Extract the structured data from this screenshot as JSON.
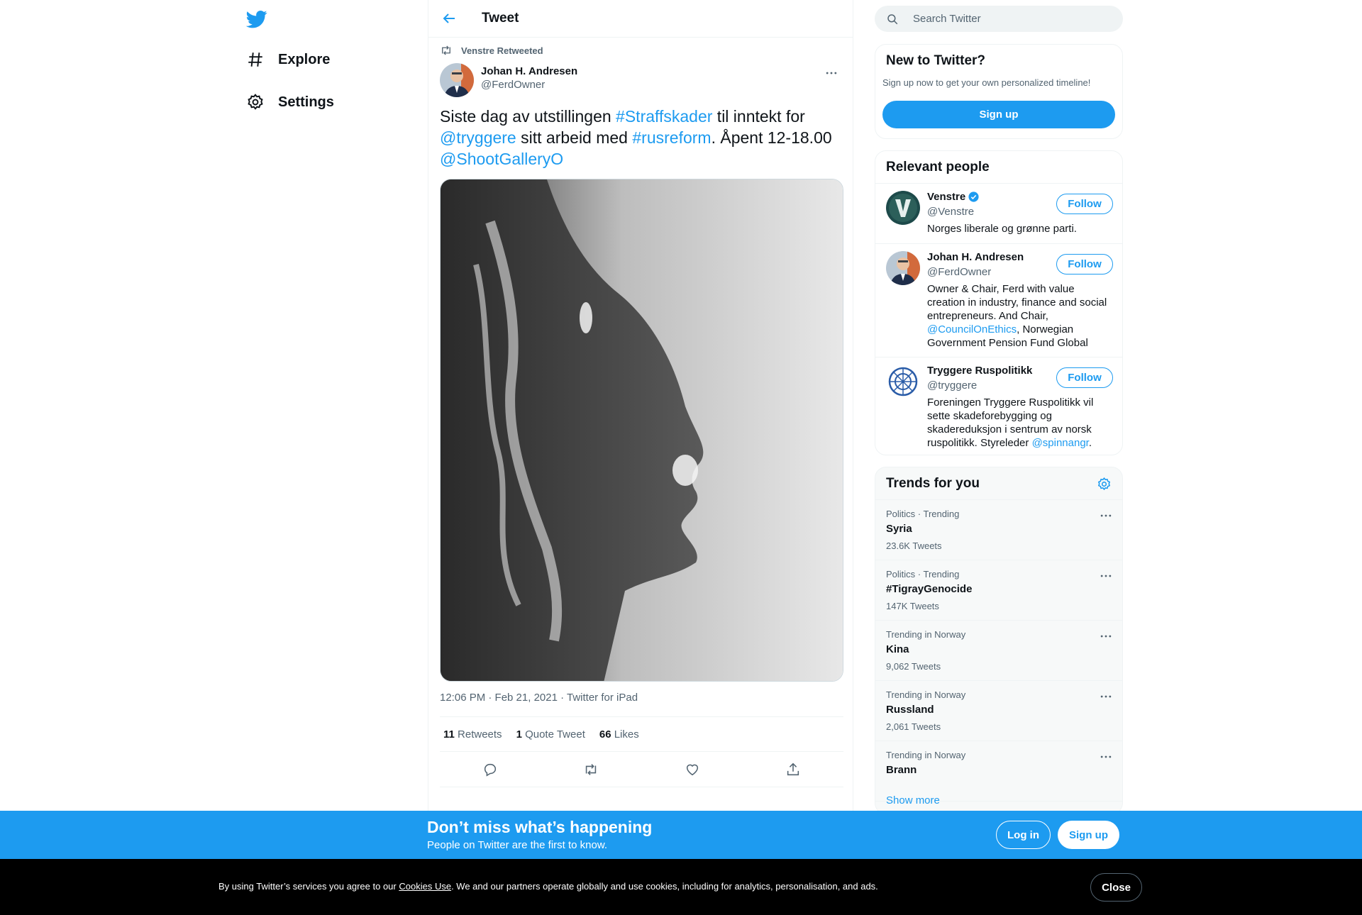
{
  "nav": {
    "logo_icon": "twitter-bird-icon",
    "items": [
      {
        "label": "Explore",
        "icon": "hashtag-icon"
      },
      {
        "label": "Settings",
        "icon": "gear-icon"
      }
    ]
  },
  "header": {
    "title": "Tweet"
  },
  "tweet": {
    "retweeted_by": "Venstre Retweeted",
    "author_name": "Johan H. Andresen",
    "author_handle": "@FerdOwner",
    "text": {
      "t1": "Siste dag av utstillingen ",
      "tag1": "#Straffskader",
      "t2": " til inntekt for ",
      "mention1": "@tryggere",
      "t3": " sitt arbeid med ",
      "tag2": "#rusreform",
      "t4": ". Åpent 12-18.00 ",
      "mention2": "@ShootGalleryO"
    },
    "meta": "12:06 PM · Feb 21, 2021 · Twitter for iPad",
    "stats": {
      "retweets_count": "11",
      "retweets_label": "Retweets",
      "quotes_count": "1",
      "quotes_label": "Quote Tweet",
      "likes_count": "66",
      "likes_label": "Likes"
    }
  },
  "search": {
    "placeholder": "Search Twitter"
  },
  "new_to_twitter": {
    "title": "New to Twitter?",
    "subtitle": "Sign up now to get your own personalized timeline!",
    "button": "Sign up"
  },
  "relevant": {
    "title": "Relevant people",
    "follow_label": "Follow",
    "people": [
      {
        "name": "Venstre",
        "handle": "@Venstre",
        "bio": "Norges liberale og grønne parti."
      },
      {
        "name": "Johan H. Andresen",
        "handle": "@FerdOwner",
        "bio_a": "Owner & Chair, Ferd with value creation in industry, finance and social entrepreneurs. And Chair, ",
        "bio_link": "@CouncilOnEthics",
        "bio_b": ", Norwegian Government Pension Fund Global"
      },
      {
        "name": "Tryggere Ruspolitikk",
        "handle": "@tryggere",
        "bio_a": "Foreningen Tryggere Ruspolitikk vil sette skadeforebygging og skadereduksjon i sentrum av norsk ruspolitikk. Styreleder ",
        "bio_link": "@spinnangr",
        "bio_b": "."
      }
    ]
  },
  "trends": {
    "title": "Trends for you",
    "items": [
      {
        "context": "Politics · Trending",
        "name": "Syria",
        "count": "23.6K Tweets"
      },
      {
        "context": "Politics · Trending",
        "name": "#TigrayGenocide",
        "count": "147K Tweets"
      },
      {
        "context": "Trending in Norway",
        "name": "Kina",
        "count": "9,062 Tweets"
      },
      {
        "context": "Trending in Norway",
        "name": "Russland",
        "count": "2,061 Tweets"
      },
      {
        "context": "Trending in Norway",
        "name": "Brann",
        "count": ""
      }
    ],
    "show_more": "Show more"
  },
  "banner": {
    "headline": "Don’t miss what’s happening",
    "sub": "People on Twitter are the first to know.",
    "login": "Log in",
    "signup": "Sign up"
  },
  "cookie": {
    "before": "By using Twitter’s services you agree to our ",
    "link": "Cookies Use",
    "after": ". We and our partners operate globally and use cookies, including for analytics, personalisation, and ads.",
    "close": "Close"
  },
  "colors": {
    "accent": "#1d9bf0",
    "text": "#0f1419",
    "muted": "#536471"
  }
}
